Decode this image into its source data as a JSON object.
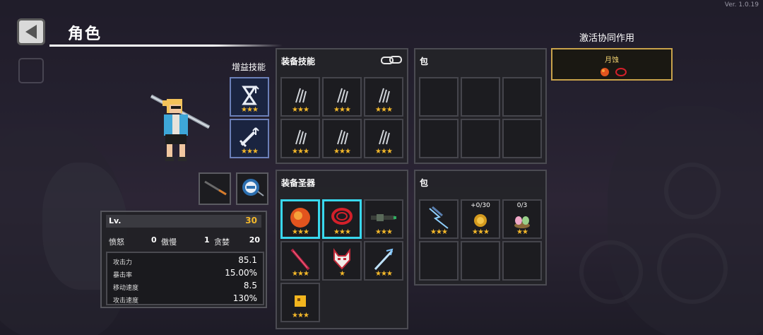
{
  "version": "Ver. 1.0.19",
  "header": {
    "title": "角色"
  },
  "buff_skills": {
    "label": "增益技能",
    "slots": [
      {
        "stars": "★★★",
        "icon": "hourglass-up-icon"
      },
      {
        "stars": "★★★",
        "icon": "sword-up-icon"
      }
    ]
  },
  "equipped_skills": {
    "title": "装备技能",
    "link_icon": "chain-link-icon",
    "slots": [
      {
        "stars": "★★★"
      },
      {
        "stars": "★★★"
      },
      {
        "stars": "★★★"
      },
      {
        "stars": "★★★"
      },
      {
        "stars": "★★★"
      },
      {
        "stars": "★★★"
      }
    ]
  },
  "bag_skills": {
    "title": "包"
  },
  "equipped_relics": {
    "title": "装备圣器",
    "slots": [
      {
        "stars": "★★★",
        "icon": "fire-orb-icon"
      },
      {
        "stars": "★★★",
        "icon": "red-ring-icon"
      },
      {
        "stars": "★★★",
        "icon": "dark-gun-icon"
      },
      {
        "stars": "★★★",
        "icon": "flame-sword-icon"
      },
      {
        "stars": "★",
        "icon": "fox-mask-icon"
      },
      {
        "stars": "★★★",
        "icon": "lightning-staff-icon"
      },
      {
        "stars": "★★★",
        "icon": "gold-cube-icon"
      }
    ]
  },
  "bag_relics": {
    "title": "包",
    "slots": [
      {
        "stars": "★★★",
        "icon": "lightning-claw-icon",
        "count": ""
      },
      {
        "stars": "★★★",
        "icon": "gold-coin-icon",
        "count": "+0/30"
      },
      {
        "stars": "★★",
        "icon": "eggs-nest-icon",
        "count": "0/3"
      }
    ]
  },
  "stats": {
    "level_label": "Lv.",
    "level": "30",
    "sins": [
      {
        "value": "0",
        "name": "傲慢"
      },
      {
        "value": "1",
        "name": "贪婪"
      }
    ],
    "sins_left_label": "愤怒",
    "sins_right_value": "20",
    "rows": [
      {
        "label": "攻击力",
        "value": "85.1"
      },
      {
        "label": "暴击率",
        "value": "15.00%"
      },
      {
        "label": "移动速度",
        "value": "8.5"
      },
      {
        "label": "攻击速度",
        "value": "130%"
      }
    ]
  },
  "synergy": {
    "title": "激活协同作用",
    "name": "月蚀"
  },
  "colors": {
    "highlight": "#39d8ee",
    "star": "#f4b82a",
    "level": "#f4b82a",
    "synergy_border": "#c8a24a"
  }
}
